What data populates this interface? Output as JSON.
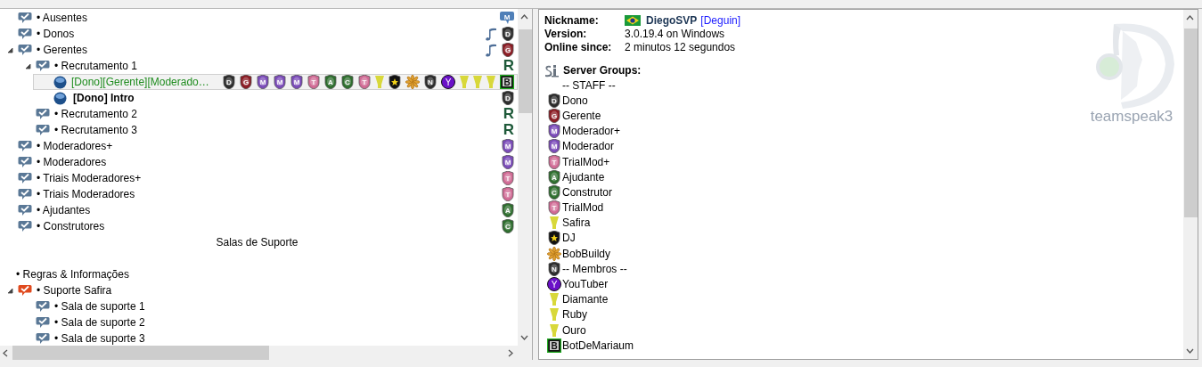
{
  "channel_tree": [
    {
      "kind": "channel",
      "label": "• Ausentes",
      "color": "#5a7896",
      "badges": [
        {
          "kind": "chat",
          "letter": "M",
          "color": "#4f7fb8"
        }
      ]
    },
    {
      "kind": "channel",
      "label": "• Donos",
      "color": "#5a7896",
      "badges": [
        {
          "kind": "note"
        },
        {
          "kind": "shield",
          "letter": "D",
          "color": "#2a2a2a"
        }
      ]
    },
    {
      "kind": "channel",
      "label": "• Gerentes",
      "color": "#5a7896",
      "expanded": true,
      "badges": [
        {
          "kind": "note"
        },
        {
          "kind": "shield",
          "letter": "G",
          "color": "#8a1a22"
        }
      ],
      "children": [
        {
          "kind": "channel",
          "label": "• Recrutamento 1",
          "color": "#5a7896",
          "expanded": true,
          "badges": [
            {
              "kind": "letter",
              "letter": "R",
              "color": "#1f5a3a"
            }
          ],
          "children": [
            {
              "kind": "client",
              "label": "[Dono][Gerente][Moderado…",
              "selected": true,
              "bold": false,
              "color": "#1e8c1e",
              "badges": [
                {
                  "kind": "shield",
                  "letter": "D",
                  "color": "#2a2a2a"
                },
                {
                  "kind": "shield",
                  "letter": "G",
                  "color": "#8a1a22"
                },
                {
                  "kind": "shield",
                  "letter": "M",
                  "color": "#7a4ab8"
                },
                {
                  "kind": "shield",
                  "letter": "M",
                  "color": "#7a4ab8"
                },
                {
                  "kind": "shield",
                  "letter": "M",
                  "color": "#7a4ab8"
                },
                {
                  "kind": "shield",
                  "letter": "T",
                  "color": "#d06a94"
                },
                {
                  "kind": "shield",
                  "letter": "A",
                  "color": "#2e6e2e"
                },
                {
                  "kind": "shield",
                  "letter": "C",
                  "color": "#2e6e2e"
                },
                {
                  "kind": "shield",
                  "letter": "T",
                  "color": "#d06a94"
                },
                {
                  "kind": "cup"
                },
                {
                  "kind": "star_shield"
                },
                {
                  "kind": "flower"
                },
                {
                  "kind": "shield",
                  "letter": "N",
                  "color": "#2a2a2a"
                },
                {
                  "kind": "circle",
                  "letter": "Y",
                  "color": "#6a10c8"
                },
                {
                  "kind": "cup"
                },
                {
                  "kind": "cup"
                },
                {
                  "kind": "cup"
                },
                {
                  "kind": "bot",
                  "letter": "B"
                }
              ]
            },
            {
              "kind": "client",
              "label": "[Dono] Intro",
              "selected": false,
              "bold": true,
              "color": "#000000",
              "badges": [
                {
                  "kind": "shield",
                  "letter": "D",
                  "color": "#2a2a2a"
                }
              ]
            }
          ]
        },
        {
          "kind": "channel",
          "label": "• Recrutamento 2",
          "color": "#5a7896",
          "badges": [
            {
              "kind": "letter",
              "letter": "R",
              "color": "#1f5a3a"
            }
          ]
        },
        {
          "kind": "channel",
          "label": "• Recrutamento 3",
          "color": "#5a7896",
          "badges": [
            {
              "kind": "letter",
              "letter": "R",
              "color": "#1f5a3a"
            }
          ]
        }
      ]
    },
    {
      "kind": "channel",
      "label": "• Moderadores+",
      "color": "#5a7896",
      "badges": [
        {
          "kind": "shield",
          "letter": "M",
          "color": "#7a4ab8"
        }
      ]
    },
    {
      "kind": "channel",
      "label": "• Moderadores",
      "color": "#5a7896",
      "badges": [
        {
          "kind": "shield",
          "letter": "M",
          "color": "#7a4ab8"
        }
      ]
    },
    {
      "kind": "channel",
      "label": "• Triais Moderadores+",
      "color": "#5a7896",
      "badges": [
        {
          "kind": "shield",
          "letter": "T",
          "color": "#d06a94"
        }
      ]
    },
    {
      "kind": "channel",
      "label": "• Triais Moderadores",
      "color": "#5a7896",
      "badges": [
        {
          "kind": "shield",
          "letter": "T",
          "color": "#d06a94"
        }
      ]
    },
    {
      "kind": "channel",
      "label": "• Ajudantes",
      "color": "#5a7896",
      "badges": [
        {
          "kind": "shield",
          "letter": "A",
          "color": "#2e6e2e"
        }
      ]
    },
    {
      "kind": "channel",
      "label": "• Construtores",
      "color": "#5a7896",
      "badges": [
        {
          "kind": "shield",
          "letter": "C",
          "color": "#2e6e2e"
        }
      ]
    },
    {
      "kind": "center_spacer",
      "label": "Salas de Suporte"
    },
    {
      "kind": "blank"
    },
    {
      "kind": "left_spacer",
      "label": "• Regras & Informações"
    },
    {
      "kind": "channel",
      "label": "• Suporte Safira",
      "color": "#e04a1e",
      "expanded": true,
      "children": [
        {
          "kind": "channel",
          "label": "• Sala de suporte 1",
          "color": "#5a7896"
        },
        {
          "kind": "channel",
          "label": "• Sala de suporte 2",
          "color": "#5a7896"
        },
        {
          "kind": "channel",
          "label": "• Sala de suporte 3",
          "color": "#5a7896"
        }
      ]
    }
  ],
  "client_info": {
    "fields": [
      {
        "kind": "nickname",
        "label": "Nickname:",
        "value": "DiegoSVP",
        "tag": "[Deguin]"
      },
      {
        "kind": "text",
        "label": "Version:",
        "value": "3.0.19.4 on Windows"
      },
      {
        "kind": "text",
        "label": "Online since:",
        "value": "2 minutos 12 segundos"
      }
    ],
    "server_groups_title": "Server Groups:",
    "server_groups": [
      {
        "label": "-- STAFF --"
      },
      {
        "label": "Dono",
        "badge": {
          "kind": "shield",
          "letter": "D",
          "color": "#2a2a2a"
        }
      },
      {
        "label": "Gerente",
        "badge": {
          "kind": "shield",
          "letter": "G",
          "color": "#8a1a22"
        }
      },
      {
        "label": "Moderador+",
        "badge": {
          "kind": "shield",
          "letter": "M",
          "color": "#7a4ab8"
        }
      },
      {
        "label": "Moderador",
        "badge": {
          "kind": "shield",
          "letter": "M",
          "color": "#7a4ab8"
        }
      },
      {
        "label": "TrialMod+",
        "badge": {
          "kind": "shield",
          "letter": "T",
          "color": "#d06a94"
        }
      },
      {
        "label": "Ajudante",
        "badge": {
          "kind": "shield",
          "letter": "A",
          "color": "#2e6e2e"
        }
      },
      {
        "label": "Construtor",
        "badge": {
          "kind": "shield",
          "letter": "C",
          "color": "#2e6e2e"
        }
      },
      {
        "label": "TrialMod",
        "badge": {
          "kind": "shield",
          "letter": "T",
          "color": "#d06a94"
        }
      },
      {
        "label": "Safira",
        "badge": {
          "kind": "cup"
        }
      },
      {
        "label": "DJ",
        "badge": {
          "kind": "star_shield"
        }
      },
      {
        "label": "BobBuildy",
        "badge": {
          "kind": "flower"
        }
      },
      {
        "label": "-- Membros --",
        "badge": {
          "kind": "shield",
          "letter": "N",
          "color": "#2a2a2a"
        }
      },
      {
        "label": "YouTuber",
        "badge": {
          "kind": "circle",
          "letter": "Y",
          "color": "#6a10c8"
        }
      },
      {
        "label": "Diamante",
        "badge": {
          "kind": "cup"
        }
      },
      {
        "label": "Ruby",
        "badge": {
          "kind": "cup"
        }
      },
      {
        "label": "Ouro",
        "badge": {
          "kind": "cup"
        }
      },
      {
        "label": "BotDeMariaum",
        "badge": {
          "kind": "bot",
          "letter": "B"
        }
      }
    ],
    "logo_text": "teamspeak3"
  }
}
